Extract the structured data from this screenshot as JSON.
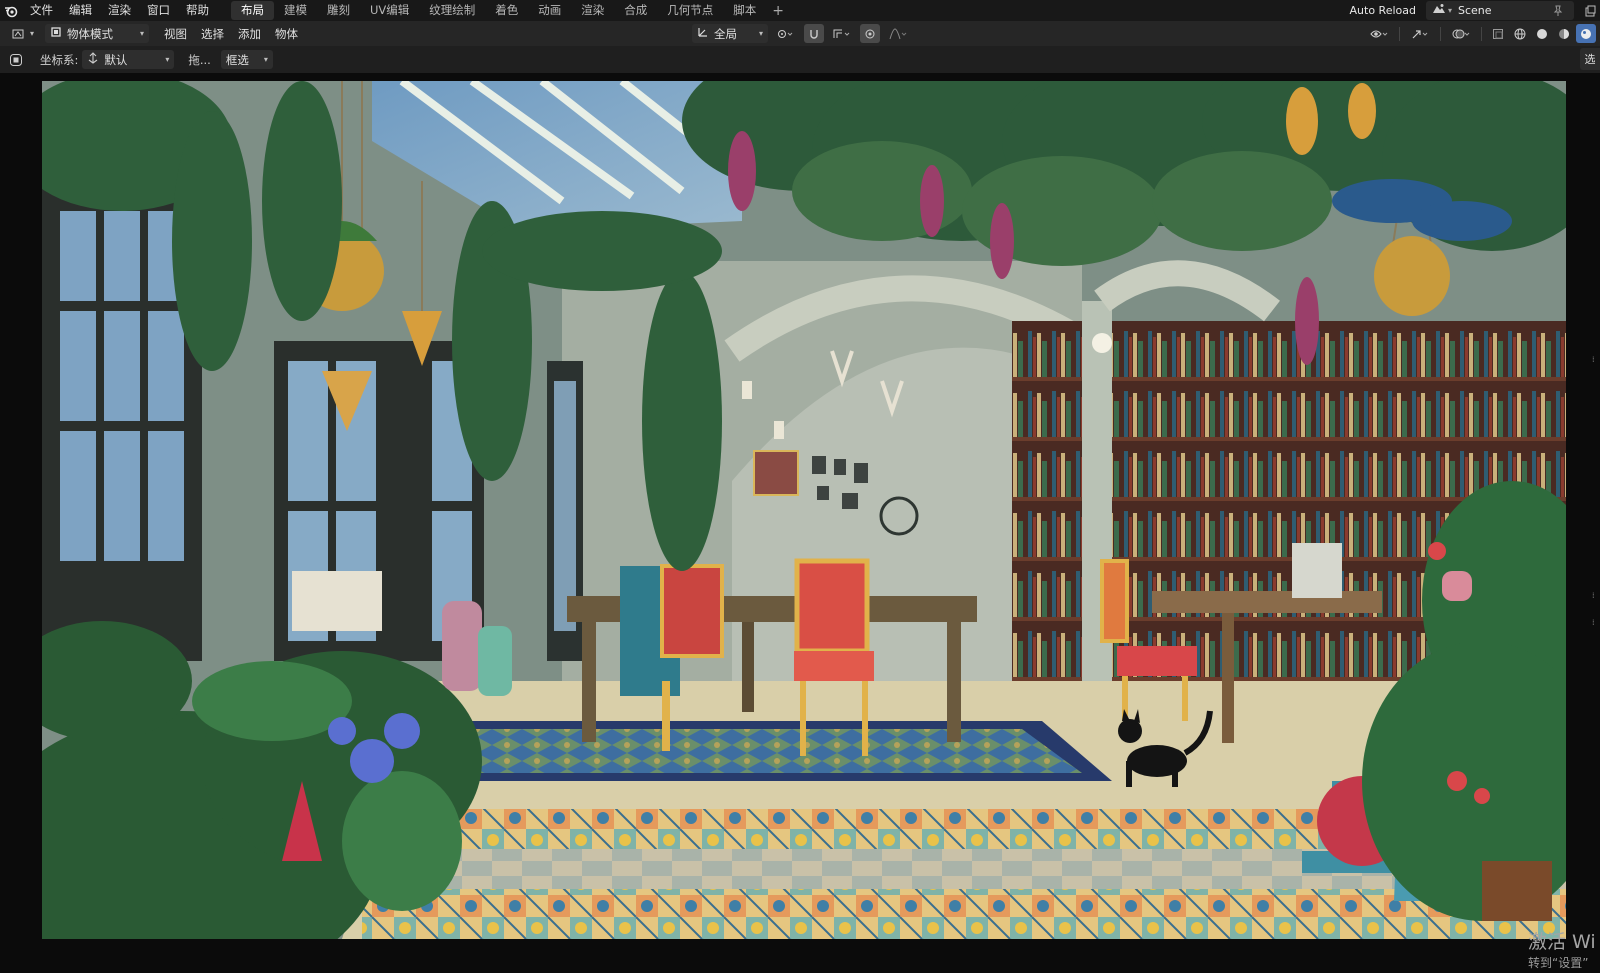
{
  "menubar": {
    "items": [
      "文件",
      "编辑",
      "渲染",
      "窗口",
      "帮助"
    ],
    "workspaces": [
      "布局",
      "建模",
      "雕刻",
      "UV编辑",
      "纹理绘制",
      "着色",
      "动画",
      "渲染",
      "合成",
      "几何节点",
      "脚本"
    ],
    "active_workspace": "布局",
    "auto_reload": "Auto Reload",
    "scene": "Scene"
  },
  "header": {
    "mode": "物体模式",
    "menus": [
      "视图",
      "选择",
      "添加",
      "物体"
    ],
    "orientation": "全局"
  },
  "toolbar": {
    "coord_label": "坐标系:",
    "coord_value": "默认",
    "drag_label": "拖...",
    "select_mode": "框选",
    "right_tab": "选"
  },
  "watermark": {
    "line1": "激活 Wi",
    "line2": "转到“设置”"
  },
  "colors": {
    "topbar_bg": "#181818",
    "header_bg": "#262626",
    "accent_active_tab": "#303030",
    "viewport_bg": "#0b0b0b"
  }
}
